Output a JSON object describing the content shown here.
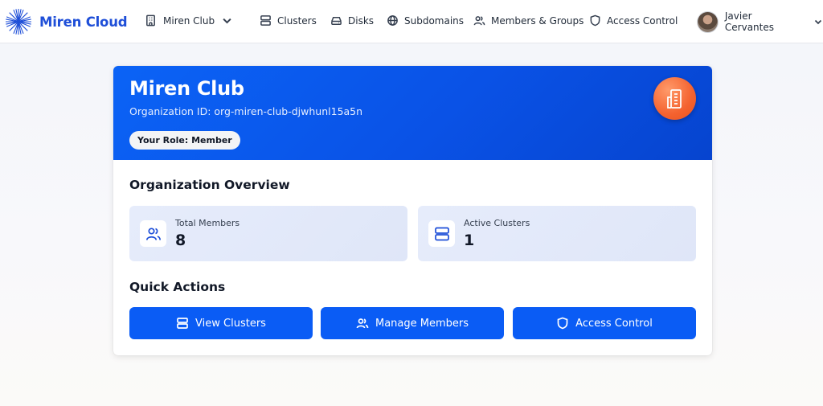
{
  "brand": {
    "name": "Miren Cloud",
    "logo_icon": "starburst-logo",
    "color": "#1f4fd8"
  },
  "org_switcher": {
    "label": "Miren Club",
    "icon": "building-icon"
  },
  "nav": {
    "items": [
      {
        "label": "Clusters",
        "icon": "server-icon"
      },
      {
        "label": "Disks",
        "icon": "disk-icon"
      },
      {
        "label": "Subdomains",
        "icon": "globe-icon"
      },
      {
        "label": "Members & Groups",
        "icon": "users-icon"
      },
      {
        "label": "Access Control",
        "icon": "shield-icon"
      }
    ]
  },
  "user": {
    "name": "Javier Cervantes"
  },
  "org_header": {
    "title": "Miren Club",
    "org_id": "Organization ID: org-miren-club-djwhunl15a5n",
    "role_badge": "Your Role: Member",
    "header_color": "#0b63f6",
    "icon_color": "#f4622f"
  },
  "overview": {
    "title": "Organization Overview",
    "stats": [
      {
        "label": "Total Members",
        "value": "8",
        "icon": "users-icon"
      },
      {
        "label": "Active Clusters",
        "value": "1",
        "icon": "server-icon"
      }
    ]
  },
  "quick_actions": {
    "title": "Quick Actions",
    "buttons": [
      {
        "label": "View Clusters",
        "icon": "server-icon"
      },
      {
        "label": "Manage Members",
        "icon": "users-icon"
      },
      {
        "label": "Access Control",
        "icon": "shield-icon"
      }
    ],
    "button_color": "#0a5cf5"
  }
}
